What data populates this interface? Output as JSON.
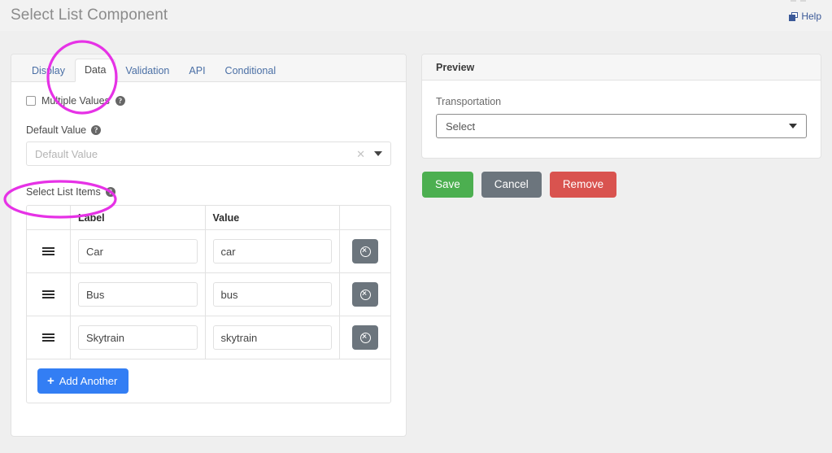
{
  "header": {
    "title": "Select List Component",
    "help_label": "Help",
    "help_icon": "external-window-icon"
  },
  "tabs": [
    {
      "label": "Display",
      "active": false
    },
    {
      "label": "Data",
      "active": true
    },
    {
      "label": "Validation",
      "active": false
    },
    {
      "label": "API",
      "active": false
    },
    {
      "label": "Conditional",
      "active": false
    }
  ],
  "settings": {
    "multiple_values": {
      "label": "Multiple Values",
      "checked": false,
      "help_icon": "question-mark-icon"
    },
    "default_value": {
      "label": "Default Value",
      "placeholder": "Default Value",
      "value": "",
      "clear_icon": "clear-x-icon",
      "caret_icon": "chevron-down-icon",
      "help_icon": "question-mark-icon"
    },
    "select_list_items": {
      "label": "Select List Items",
      "help_icon": "question-mark-icon",
      "columns": [
        "Label",
        "Value"
      ],
      "rows": [
        {
          "label": "Car",
          "value": "car",
          "handle_icon": "drag-handle-icon",
          "remove_icon": "remove-circle-icon"
        },
        {
          "label": "Bus",
          "value": "bus",
          "handle_icon": "drag-handle-icon",
          "remove_icon": "remove-circle-icon"
        },
        {
          "label": "Skytrain",
          "value": "skytrain",
          "handle_icon": "drag-handle-icon",
          "remove_icon": "remove-circle-icon"
        }
      ],
      "add_button": {
        "label": "Add Another",
        "icon": "plus-icon"
      }
    }
  },
  "preview": {
    "title": "Preview",
    "field_label": "Transportation",
    "select_text": "Select",
    "caret_icon": "chevron-down-icon"
  },
  "actions": [
    {
      "label": "Save",
      "color": "#4caf50"
    },
    {
      "label": "Cancel",
      "color": "#6c757d"
    },
    {
      "label": "Remove",
      "color": "#d9534f"
    }
  ],
  "annotations": {
    "color": "#e632e6",
    "shapes": [
      "circle-around-data-tab",
      "ellipse-around-select-list-items"
    ]
  }
}
